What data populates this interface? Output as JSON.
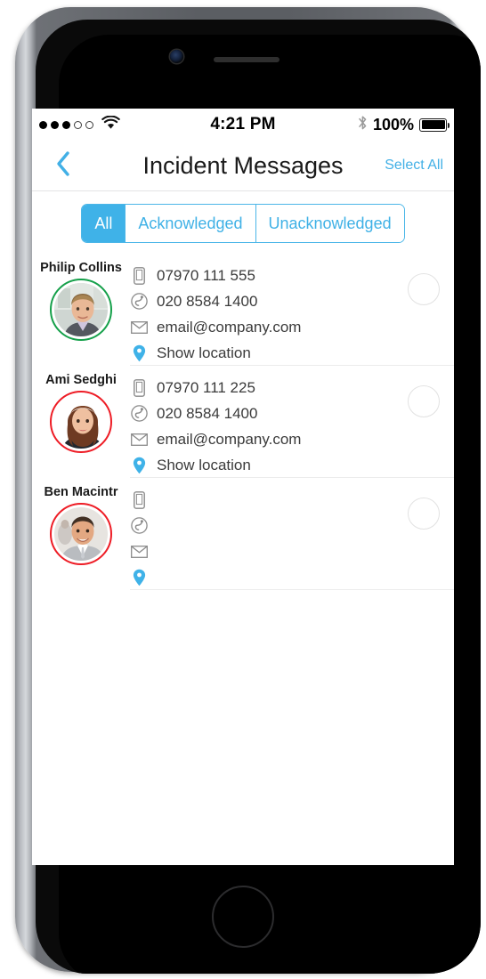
{
  "status_bar": {
    "signal_dots_filled": 3,
    "signal_dots_empty": 2,
    "wifi_icon": "wifi-icon",
    "time": "4:21 PM",
    "bluetooth_icon": "bluetooth-icon",
    "battery_percent": "100%",
    "battery_level": 100
  },
  "nav": {
    "back_icon": "chevron-left-icon",
    "title": "Incident Messages",
    "select_all_label": "Select All"
  },
  "filter_tabs": {
    "active_index": 0,
    "items": [
      {
        "label": "All"
      },
      {
        "label": "Acknowledged"
      },
      {
        "label": "Unacknowledged"
      }
    ]
  },
  "colors": {
    "accent_blue": "#3fb2e8",
    "link_blue": "#42b0e6",
    "ring_green": "#15a04a",
    "ring_red": "#ee1c25",
    "pin_blue": "#3fb2e8",
    "icon_gray": "#8a8a8a",
    "separator": "#ececec"
  },
  "contacts": [
    {
      "name": "Philip Collins",
      "ring_color": "#15a04a",
      "avatar_name": "avatar-philip-collins",
      "mobile": "07970 111 555",
      "phone": "020 8584 1400",
      "email": "email@company.com",
      "location_label": "Show location",
      "selected": false
    },
    {
      "name": "Ami Sedghi",
      "ring_color": "#ee1c25",
      "avatar_name": "avatar-ami-sedghi",
      "mobile": "07970 111 225",
      "phone": "020 8584 1400",
      "email": "email@company.com",
      "location_label": "Show location",
      "selected": false
    },
    {
      "name": "Ben Macintr",
      "ring_color": "#ee1c25",
      "avatar_name": "avatar-ben-macintr",
      "mobile": "",
      "phone": "",
      "email": "",
      "location_label": "",
      "selected": false
    }
  ],
  "icon_names": {
    "mobile": "mobile-phone-icon",
    "phone": "telephone-icon",
    "email": "envelope-icon",
    "location": "map-pin-icon",
    "select": "selection-circle-icon"
  }
}
